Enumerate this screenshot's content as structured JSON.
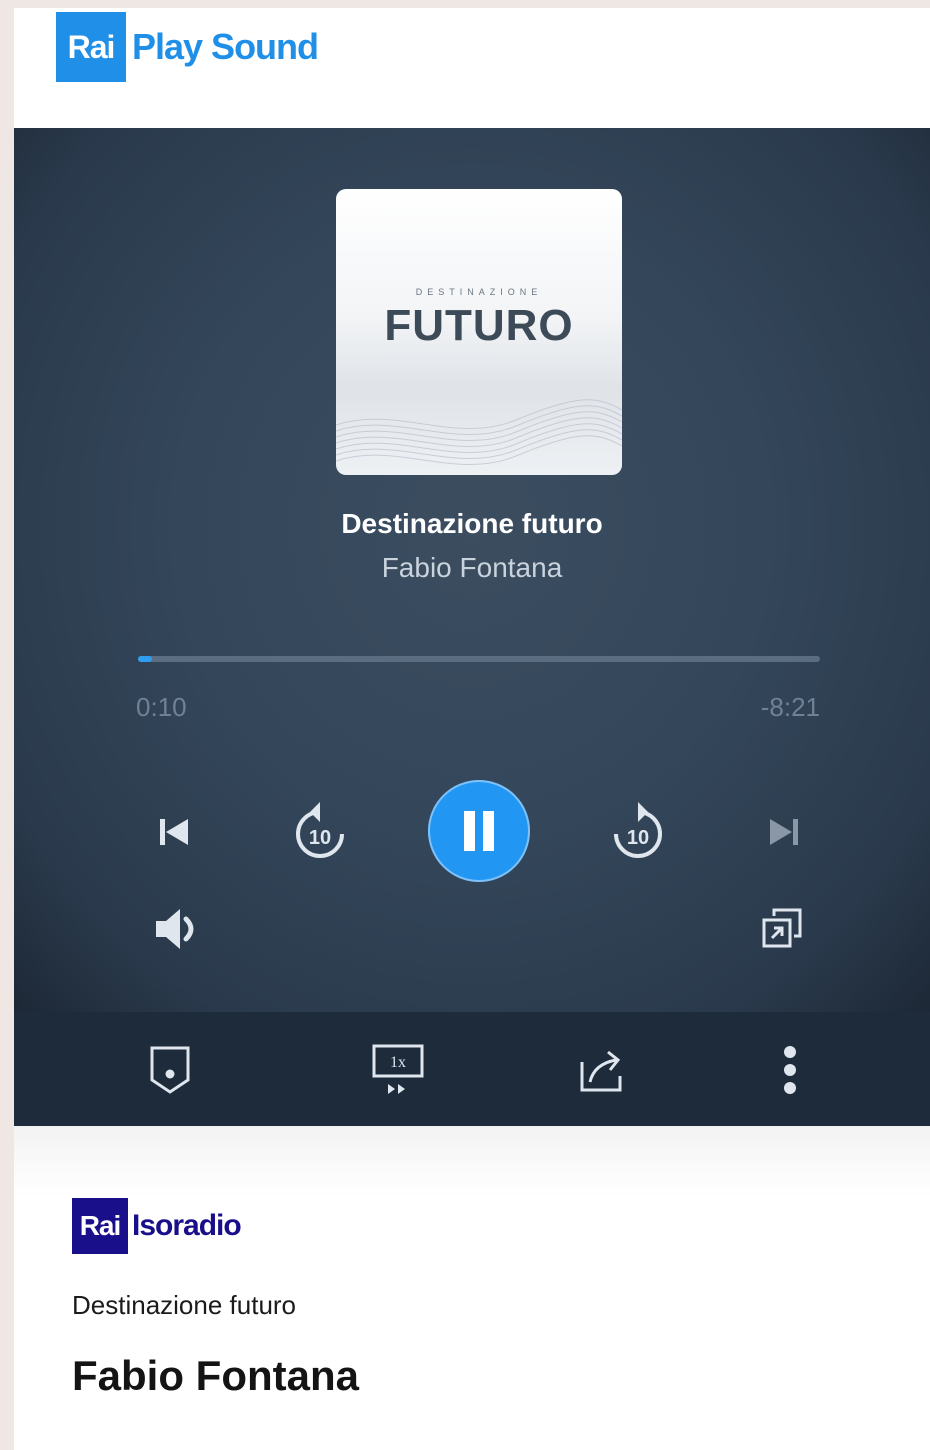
{
  "header": {
    "logo_box": "Rai",
    "logo_text": "Play Sound"
  },
  "player": {
    "cover": {
      "small_text": "DESTINAZIONE",
      "big_text": "FUTURO"
    },
    "track_title": "Destinazione futuro",
    "artist": "Fabio Fontana",
    "progress": {
      "elapsed": "0:10",
      "remaining": "-8:21",
      "fraction": 0.02
    },
    "controls": [
      "skip-previous-icon",
      "replay-10-icon",
      "pause-icon",
      "forward-10-icon",
      "skip-next-icon",
      "volume-icon",
      "pip-icon"
    ],
    "replay_label": "10",
    "forward_label": "10"
  },
  "toolbar": {
    "speed_label": "1x",
    "items": [
      "bookmark-icon",
      "playback-speed-icon",
      "share-icon",
      "more-vert-icon"
    ]
  },
  "info": {
    "channel_box": "Rai",
    "channel_text": "Isoradio",
    "program": "Destinazione futuro",
    "host": "Fabio Fontana"
  },
  "colors": {
    "brand_blue": "#1f8fe8",
    "play_button": "#2196f3",
    "toolbar_bg": "#1d2b3b",
    "channel_blue": "#1a0f8a"
  }
}
